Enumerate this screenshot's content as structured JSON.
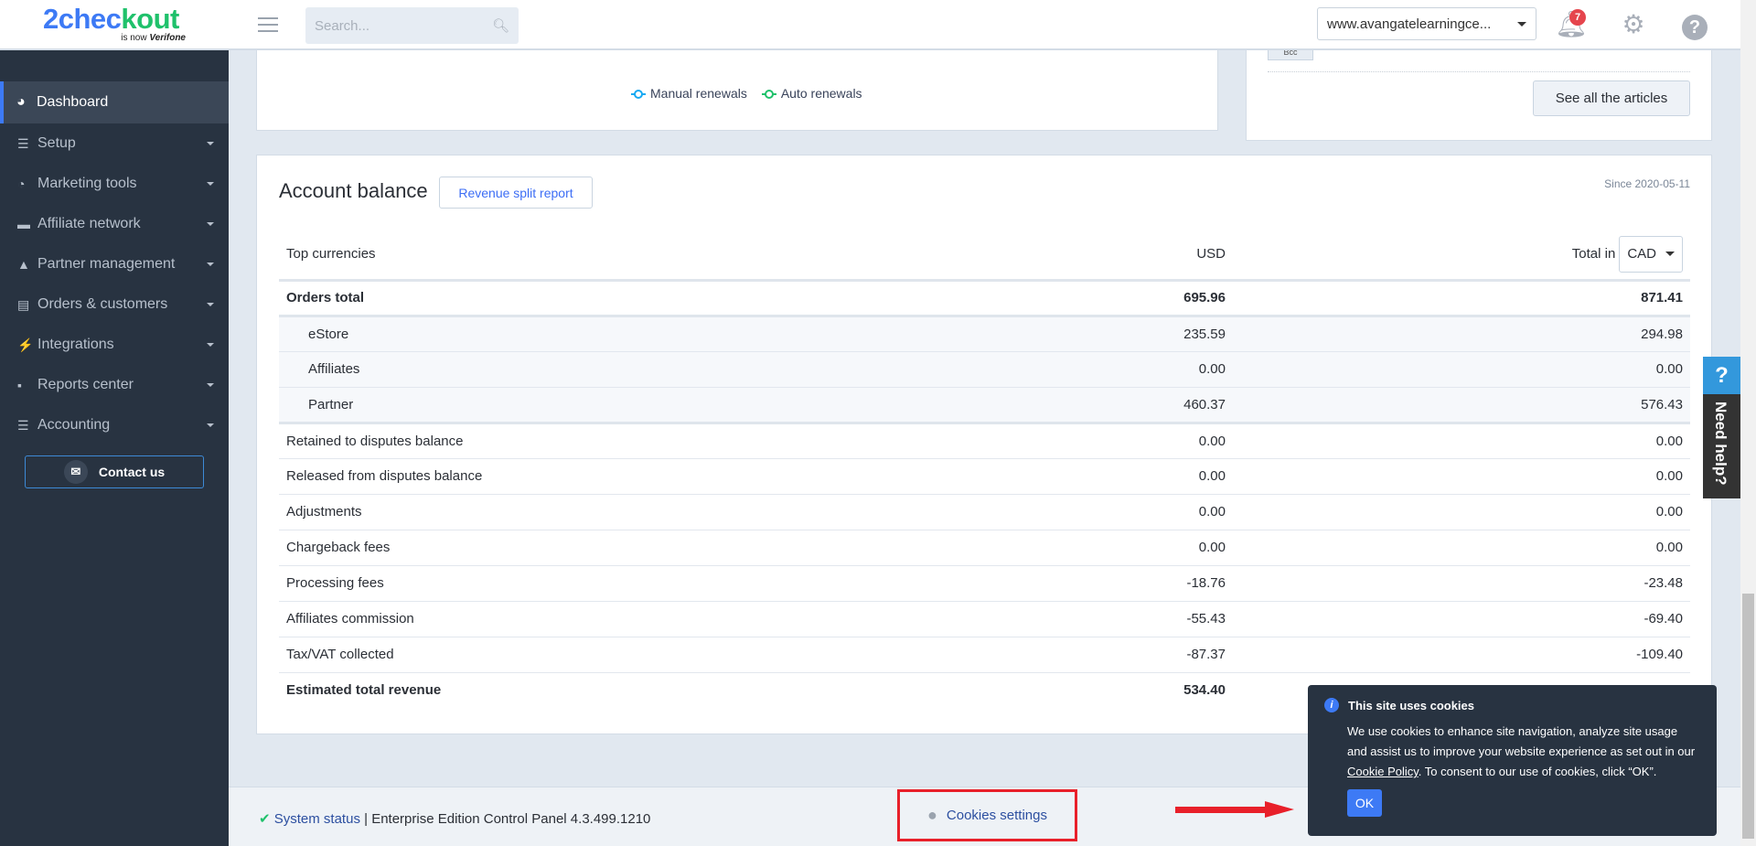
{
  "header": {
    "logo_main": "2checkout",
    "logo_sub": "is now",
    "logo_brand": "Verifone",
    "search_placeholder": "Search...",
    "domain": "www.avangatelearningce...",
    "notifications_count": "7"
  },
  "sidebar": {
    "active": "Dashboard",
    "items": [
      {
        "label": "Setup",
        "icon": "sliders-icon"
      },
      {
        "label": "Marketing tools",
        "icon": "pie-chart-icon"
      },
      {
        "label": "Affiliate network",
        "icon": "handshake-icon"
      },
      {
        "label": "Partner management",
        "icon": "sitemap-icon"
      },
      {
        "label": "Orders & customers",
        "icon": "clipboard-icon"
      },
      {
        "label": "Integrations",
        "icon": "plug-icon"
      },
      {
        "label": "Reports center",
        "icon": "bar-chart-icon"
      },
      {
        "label": "Accounting",
        "icon": "coins-icon"
      }
    ],
    "contact": "Contact us"
  },
  "renewals": {
    "legend": [
      {
        "label": "Manual renewals",
        "color": "#17a9f2"
      },
      {
        "label": "Auto renewals",
        "color": "#1fc16b"
      }
    ]
  },
  "articles": {
    "tag": "Bcc",
    "see_all": "See all the articles"
  },
  "balance": {
    "title": "Account balance",
    "report_btn": "Revenue split report",
    "since": "Since 2020-05-11",
    "headers": {
      "currencies": "Top currencies",
      "usd": "USD",
      "total_in": "Total in",
      "currency": "CAD"
    },
    "rows": [
      {
        "label": "Orders total",
        "usd": "695.96",
        "total": "871.41"
      },
      {
        "label": "eStore",
        "usd": "235.59",
        "total": "294.98"
      },
      {
        "label": "Affiliates",
        "usd": "0.00",
        "total": "0.00"
      },
      {
        "label": "Partner",
        "usd": "460.37",
        "total": "576.43"
      },
      {
        "label": "Retained to disputes balance",
        "usd": "0.00",
        "total": "0.00"
      },
      {
        "label": "Released from disputes balance",
        "usd": "0.00",
        "total": "0.00"
      },
      {
        "label": "Adjustments",
        "usd": "0.00",
        "total": "0.00"
      },
      {
        "label": "Chargeback fees",
        "usd": "0.00",
        "total": "0.00"
      },
      {
        "label": "Processing fees",
        "usd": "-18.76",
        "total": "-23.48"
      },
      {
        "label": "Affiliates commission",
        "usd": "-55.43",
        "total": "-69.40"
      },
      {
        "label": "Tax/VAT collected",
        "usd": "-87.37",
        "total": "-109.40"
      },
      {
        "label": "Estimated total revenue",
        "usd": "534.40",
        "total": ""
      }
    ]
  },
  "footer": {
    "system_status": "System status",
    "version": "| Enterprise Edition Control Panel 4.3.499.1210",
    "cookies_settings": "Cookies settings"
  },
  "cookie_banner": {
    "title": "This site uses cookies",
    "text1": "We use cookies to enhance site navigation, analyze site usage and assist us to improve your website experience as set out in our ",
    "link": "Cookie Policy",
    "text2": ". To consent to our use of cookies, click “OK”.",
    "ok": "OK"
  },
  "help_tab": {
    "label": "Need help?"
  }
}
